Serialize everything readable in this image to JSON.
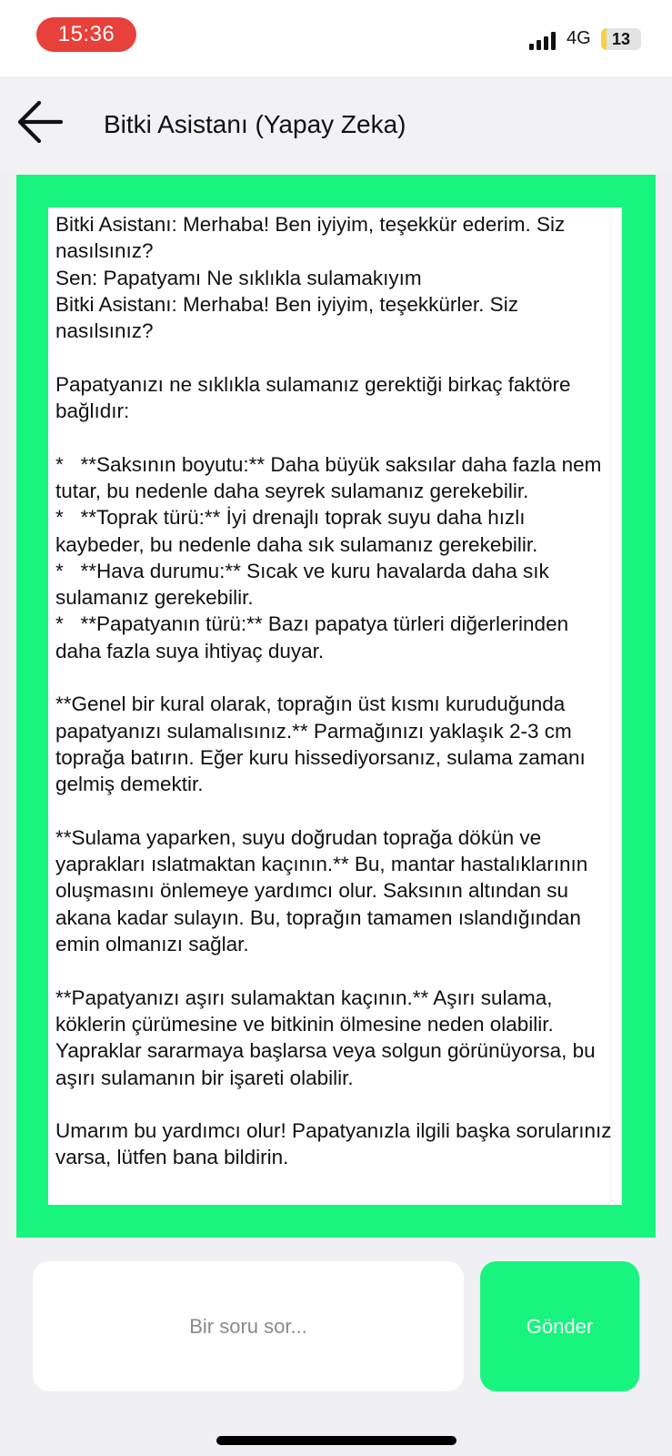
{
  "status_bar": {
    "time": "15:36",
    "network": "4G",
    "battery_level": "13",
    "battery_fraction": 0.13,
    "time_pill_color": "#e8403a",
    "battery_fill_color": "#f6d248"
  },
  "header": {
    "back_icon": "arrow-left-icon",
    "title": "Bitki Asistanı (Yapay Zeka)"
  },
  "chat": {
    "frame_color": "#18f57f",
    "transcript": "Bitki Asistanı: Merhaba! Ben iyiyim, teşekkür ederim. Siz nasılsınız?\nSen: Papatyamı Ne sıklıkla sulamakıyım\nBitki Asistanı: Merhaba! Ben iyiyim, teşekkürler. Siz nasılsınız?\n\nPapatyanızı ne sıklıkla sulamanız gerektiği birkaç faktöre bağlıdır:\n\n*   **Saksının boyutu:** Daha büyük saksılar daha fazla nem tutar, bu nedenle daha seyrek sulamanız gerekebilir.\n*   **Toprak türü:** İyi drenajlı toprak suyu daha hızlı kaybeder, bu nedenle daha sık sulamanız gerekebilir.\n*   **Hava durumu:** Sıcak ve kuru havalarda daha sık sulamanız gerekebilir.\n*   **Papatyanın türü:** Bazı papatya türleri diğerlerinden daha fazla suya ihtiyaç duyar.\n\n**Genel bir kural olarak, toprağın üst kısmı kuruduğunda papatyanızı sulamalısınız.** Parmağınızı yaklaşık 2-3 cm toprağa batırın. Eğer kuru hissediyorsanız, sulama zamanı gelmiş demektir.\n\n**Sulama yaparken, suyu doğrudan toprağa dökün ve yaprakları ıslatmaktan kaçının.** Bu, mantar hastalıklarının oluşmasını önlemeye yardımcı olur. Saksının altından su akana kadar sulayın. Bu, toprağın tamamen ıslandığından emin olmanızı sağlar.\n\n**Papatyanızı aşırı sulamaktan kaçının.** Aşırı sulama, köklerin çürümesine ve bitkinin ölmesine neden olabilir. Yapraklar sararmaya başlarsa veya solgun görünüyorsa, bu aşırı sulamanın bir işareti olabilir.\n\nUmarım bu yardımcı olur! Papatyanızla ilgili başka sorularınız varsa, lütfen bana bildirin."
  },
  "input": {
    "placeholder": "Bir soru sor...",
    "value": "",
    "send_label": "Gönder",
    "send_color": "#18f57f"
  }
}
